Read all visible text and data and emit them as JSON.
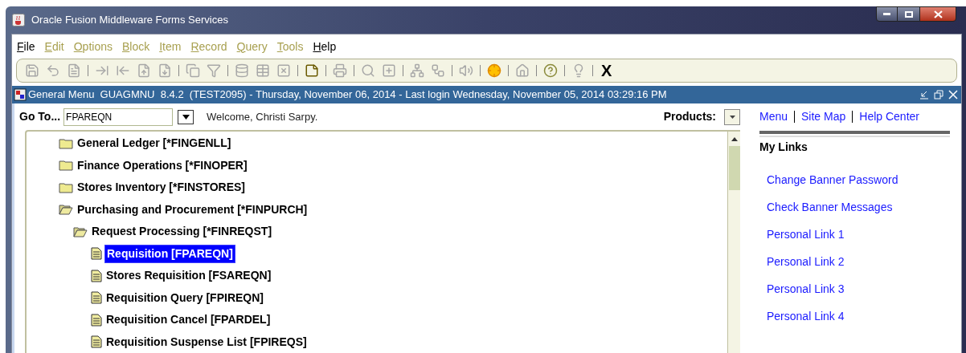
{
  "window": {
    "title": "Oracle Fusion Middleware Forms Services"
  },
  "menu": [
    {
      "label": "File",
      "disabled": false
    },
    {
      "label": "Edit",
      "disabled": true
    },
    {
      "label": "Options",
      "disabled": true
    },
    {
      "label": "Block",
      "disabled": true
    },
    {
      "label": "Item",
      "disabled": true
    },
    {
      "label": "Record",
      "disabled": true
    },
    {
      "label": "Query",
      "disabled": true
    },
    {
      "label": "Tools",
      "disabled": true
    },
    {
      "label": "Help",
      "disabled": false
    }
  ],
  "toolbar": {
    "buttons": [
      {
        "disabled": true
      },
      {
        "disabled": true
      },
      {
        "disabled": true
      },
      {
        "disabled": true
      },
      {
        "disabled": true
      },
      {
        "disabled": true
      },
      {
        "disabled": true
      },
      {
        "disabled": true
      },
      {
        "disabled": true
      },
      {
        "disabled": true
      },
      {
        "disabled": true
      },
      {
        "disabled": true
      },
      {
        "disabled": false
      },
      {
        "disabled": true
      },
      {
        "disabled": true
      },
      {
        "disabled": true
      },
      {
        "disabled": true
      },
      {
        "disabled": true
      },
      {
        "disabled": true
      },
      {
        "disabled": false
      },
      {
        "disabled": true
      },
      {
        "disabled": false
      },
      {
        "disabled": true
      }
    ],
    "exit_label": "X"
  },
  "form_header": {
    "title": "General Menu  GUAGMNU  8.4.2  (TEST2095) - Thursday, November 06, 2014 - Last login Wednesday, November 05, 2014 03:29:16 PM"
  },
  "goto": {
    "label": "Go To...",
    "value": "FPAREQN",
    "welcome": "Welcome, Christi Sarpy."
  },
  "products": {
    "label": "Products:"
  },
  "top_links": [
    "Menu",
    "Site Map",
    "Help Center"
  ],
  "tree": [
    {
      "label": "General Ledger [*FINGENLL]",
      "kind": "folder",
      "expanded": false,
      "selected": false
    },
    {
      "label": "Finance Operations [*FINOPER]",
      "kind": "folder",
      "expanded": false,
      "selected": false
    },
    {
      "label": "Stores Inventory [*FINSTORES]",
      "kind": "folder",
      "expanded": false,
      "selected": false
    },
    {
      "label": "Purchasing and Procurement [*FINPURCH]",
      "kind": "folder",
      "expanded": true,
      "selected": false,
      "children": [
        {
          "label": "Request Processing [*FINREQST]",
          "kind": "folder",
          "expanded": true,
          "selected": false,
          "children": [
            {
              "label": "Requisition [FPAREQN]",
              "kind": "form",
              "selected": true
            },
            {
              "label": "Stores Requisition [FSAREQN]",
              "kind": "form",
              "selected": false
            },
            {
              "label": "Requisition Query [FPIREQN]",
              "kind": "form",
              "selected": false
            },
            {
              "label": "Requisition Cancel [FPARDEL]",
              "kind": "form",
              "selected": false
            },
            {
              "label": "Requisition Suspense List [FPIREQS]",
              "kind": "form",
              "selected": false
            }
          ]
        }
      ]
    }
  ],
  "my_links": {
    "title": "My Links",
    "links": [
      "Change Banner Password",
      "Check Banner Messages",
      "Personal Link 1",
      "Personal Link 2",
      "Personal Link 3",
      "Personal Link 4"
    ]
  }
}
